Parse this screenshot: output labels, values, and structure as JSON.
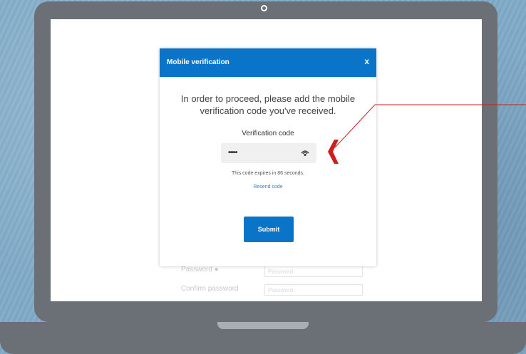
{
  "modal": {
    "title": "Mobile verification",
    "close_label": "x",
    "instructions": "In order to proceed, please add the mobile verification code you've received.",
    "code_label": "Verification code",
    "code_value": "•••••",
    "expiry_text": "This code expires in 86 seconds.",
    "resend_label": "Resend code",
    "submit_label": "Submit"
  },
  "background_form": {
    "password_label": "Password ●",
    "password_placeholder": "Password",
    "confirm_label": "Confirm password",
    "confirm_placeholder": "Password"
  },
  "colors": {
    "accent": "#0a74c9",
    "annotation": "#cc1f1f",
    "laptop": "#6b7077",
    "background": "#80abc8"
  },
  "icons": {
    "toggle_visibility": "eye-icon",
    "pointer": "chevron-left-icon"
  }
}
